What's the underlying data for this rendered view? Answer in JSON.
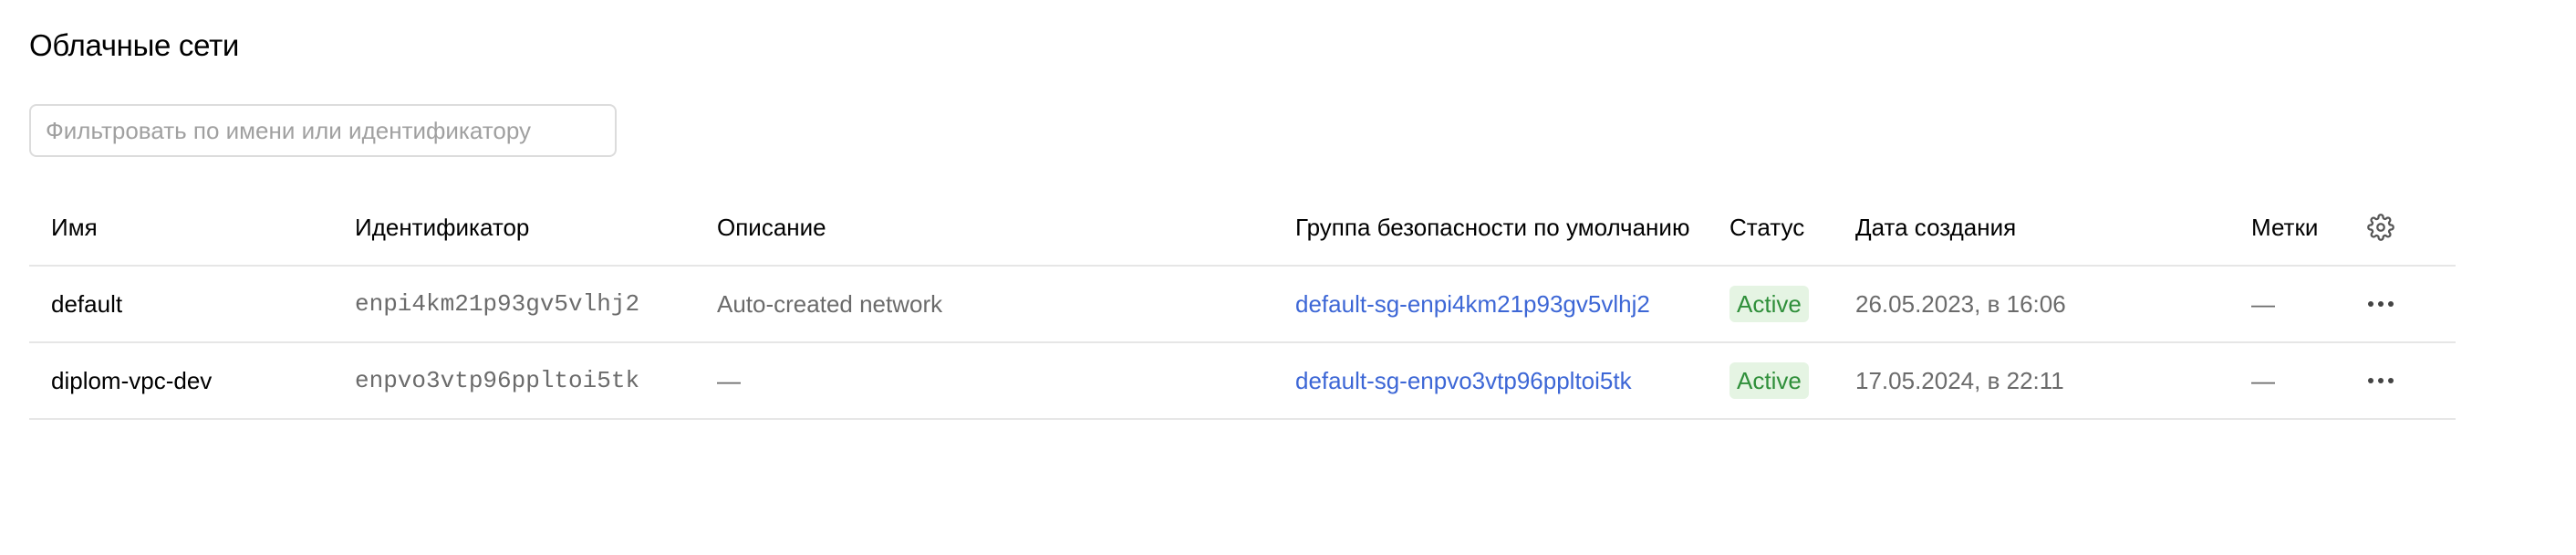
{
  "page": {
    "title": "Облачные сети"
  },
  "filter": {
    "placeholder": "Фильтровать по имени или идентификатору",
    "value": ""
  },
  "table": {
    "columns": {
      "name": "Имя",
      "id": "Идентификатор",
      "description": "Описание",
      "security_group": "Группа безопасности по умолчанию",
      "status": "Статус",
      "created": "Дата создания",
      "labels": "Метки"
    },
    "rows": [
      {
        "name": "default",
        "id": "enpi4km21p93gv5vlhj2",
        "description": "Auto-created network",
        "security_group": "default-sg-enpi4km21p93gv5vlhj2",
        "status": "Active",
        "created": "26.05.2023, в 16:06",
        "labels": "—"
      },
      {
        "name": "diplom-vpc-dev",
        "id": "enpvo3vtp96ppltoi5tk",
        "description": "—",
        "security_group": "default-sg-enpvo3vtp96ppltoi5tk",
        "status": "Active",
        "created": "17.05.2024, в 22:11",
        "labels": "—"
      }
    ]
  },
  "icons": {
    "settings": "gear-icon",
    "row_actions": "more-horizontal-icon"
  },
  "colors": {
    "link": "#3d67d6",
    "status_active_bg": "#e5f4e3",
    "status_active_text": "#2f8f3a"
  }
}
